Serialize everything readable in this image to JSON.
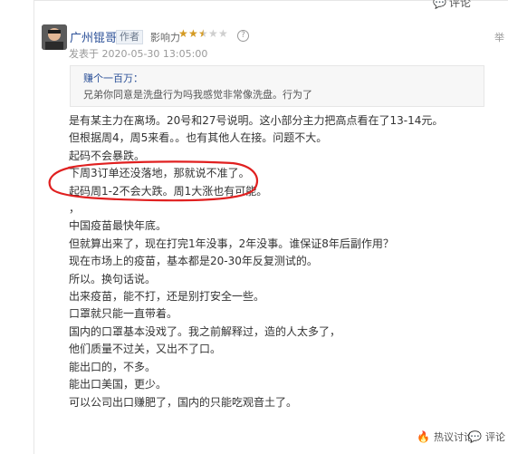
{
  "top": {
    "link_label": "评论",
    "icon": "comment-icon"
  },
  "post": {
    "author": "广州锟哥",
    "badge": "作者",
    "influence_label": "影响力",
    "influence_stars": 2.5,
    "influence_max": 5,
    "date_label": "发表于 2020-05-30 13:05:00",
    "floor": "举"
  },
  "quote": {
    "author": "赚个一百万：",
    "text": "兄弟你同意是洗盘行为吗我感觉非常像洗盘。行为了"
  },
  "body": {
    "lines": [
      "是有某主力在离场。20号和27号说明。这小部分主力把高点看在了13-14元。",
      "但根据周4，周5来看。。也有其他人在接。问题不大。",
      "起码不会暴跌。",
      "下周3订单还没落地，那就说不准了。",
      "起码周1-2不会大跌。周1大涨也有可能。",
      "，",
      "中国疫苗最快年底。",
      "但就算出来了，现在打完1年没事，2年没事。谁保证8年后副作用？",
      "现在市场上的疫苗，基本都是20-30年反复测试的。",
      "所以。换句话说。",
      "出来疫苗，能不打，还是别打安全一些。",
      "口罩就只能一直带着。",
      "国内的口罩基本没戏了。我之前解释过，造的人太多了，",
      "他们质量不过关，又出不了口。",
      "能出口的，不多。",
      "能出口美国，更少。",
      "可以公司出口赚肥了，国内的只能吃观音土了。"
    ]
  },
  "footer": {
    "hot_label": "热议讨论",
    "comment_label": "评论"
  },
  "colors": {
    "link_blue": "#2a4f97",
    "highlight_red": "#e02020",
    "star_gold": "#d49a22"
  }
}
